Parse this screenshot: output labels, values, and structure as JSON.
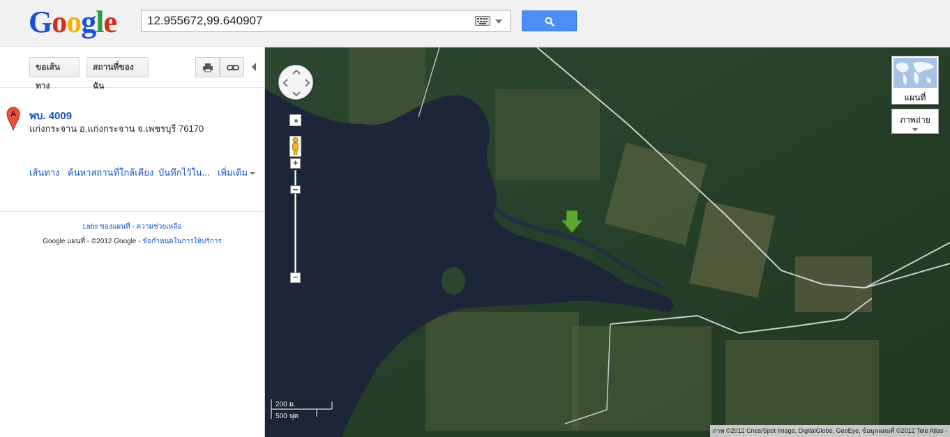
{
  "header": {
    "logo_letters": [
      "G",
      "o",
      "o",
      "g",
      "l",
      "e"
    ],
    "logo_colors": [
      "#1a4fd6",
      "#d52d1c",
      "#f0b30e",
      "#1a4fd6",
      "#2a9d3c",
      "#d52d1c"
    ],
    "search_value": "12.955672,99.640907",
    "keyboard_icon": "keyboard-icon",
    "search_icon": "search-icon",
    "accent_color": "#4d8ef5"
  },
  "panel": {
    "directions_button": "ขอเส้นทาง",
    "my_places_button": "สถานที่ของฉัน",
    "print_icon": "print-icon",
    "link_icon": "link-icon",
    "place": {
      "marker_letter": "A",
      "title": "พบ. 4009",
      "address": "แก่งกระจาน อ.แก่งกระจาน จ.เพชรบุรี 76170"
    },
    "actions": [
      "เส้นทาง",
      "ค้นหาสถานที่ใกล้เคียง",
      "บันทึกไว้ใน...",
      "เพิ่มเติม"
    ],
    "footer": {
      "labs": "Labs ของแผนที่",
      "sep1": " - ",
      "help": "ความช่วยเหลือ",
      "copyright": "Google แผนที่ - ©2012 Google - ",
      "terms": "ข้อกำหนดในการให้บริการ"
    }
  },
  "map": {
    "map_type_label": "แผนที่",
    "satellite_label": "ภาพถ่าย",
    "scale_metric": "200 ม.",
    "scale_imperial": "500 ฟุต",
    "attribution": "ภาพ ©2012 Cnes/Spot Image, DigitalGlobe, GeoEye, ข้อมูลแผนที่ ©2012 Tele Atlas -",
    "marker_color": "#5aa832"
  }
}
